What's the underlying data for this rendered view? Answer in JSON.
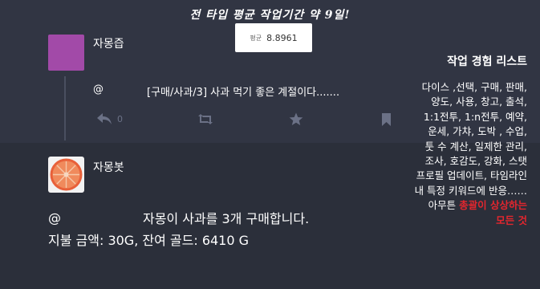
{
  "banner": "전 타입 평균 작업기간 약 9일!",
  "average": {
    "label": "평균",
    "value": "8.8961"
  },
  "post1": {
    "author": "자몽즙",
    "mention": "@",
    "text": "[구매/사과/3] 사과 먹기 좋은 계절이다.......",
    "actions": {
      "reply_count": "0",
      "reply_icon": "reply-icon",
      "boost_icon": "boost-icon",
      "favourite_icon": "star-icon",
      "bookmark_icon": "bookmark-icon"
    }
  },
  "post2": {
    "author": "자몽봇",
    "mention": "@",
    "line1": "자몽이 사과를 3개 구매합니다.",
    "line2": "지불 금액: 30G, 잔여 골드: 6410 G"
  },
  "experience": {
    "title": "작업 경험 리스트",
    "lines": [
      "다이스 ,선택, 구매, 판매,",
      "양도, 사용, 창고, 출석,",
      "1:1전투, 1:n전투, 예약,",
      "운세, 가챠, 도박 , 수업,",
      "툿 수 계산, 일제한 관리,",
      "조사, 호감도, 강화, 스탯",
      "프로필 업데이트, 타임라인",
      "내 특정 키워드에 반응……"
    ],
    "closing_prefix": "아무튼 ",
    "closing_highlight": "총괄이 상상하는",
    "closing_last": "모든 것"
  },
  "colors": {
    "accent_red": "#e3262e",
    "avatar_purple": "#a24aa8",
    "icon_gray": "#6b7186"
  }
}
